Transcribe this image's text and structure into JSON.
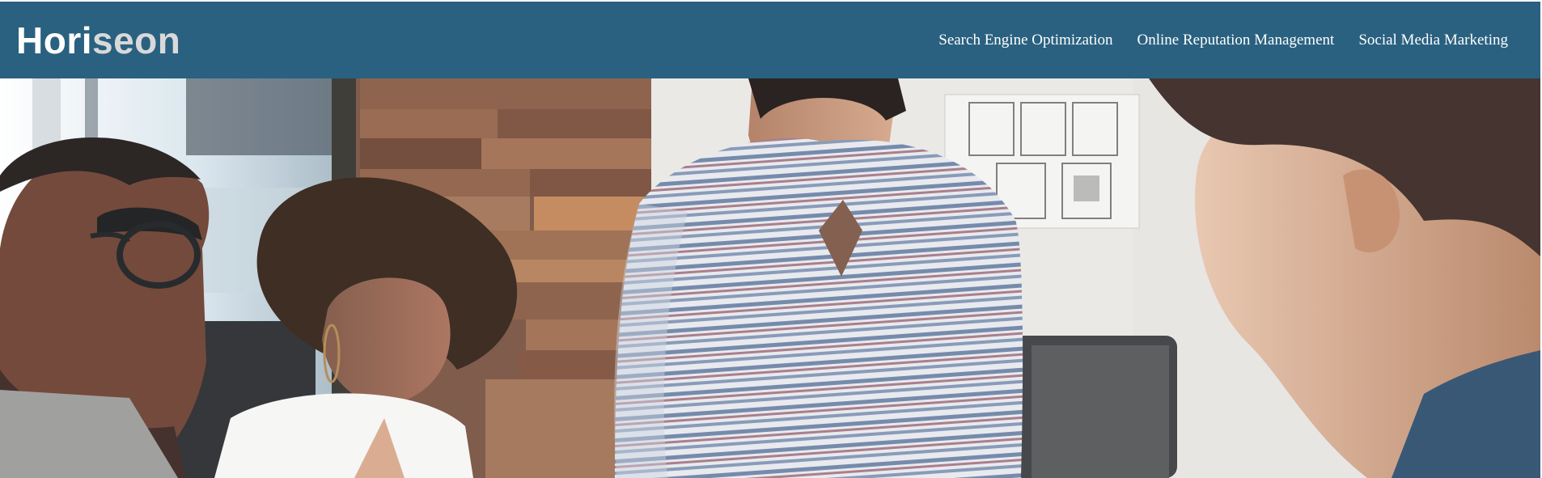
{
  "header": {
    "logo_main": "Hori",
    "logo_accent": "seon",
    "background_color": "#2a6180",
    "accent_color": "#d9d9d9"
  },
  "nav": {
    "items": [
      {
        "label": "Search Engine Optimization"
      },
      {
        "label": "Online Reputation Management"
      },
      {
        "label": "Social Media Marketing"
      }
    ]
  },
  "hero": {
    "image": "team-meeting-photo"
  }
}
